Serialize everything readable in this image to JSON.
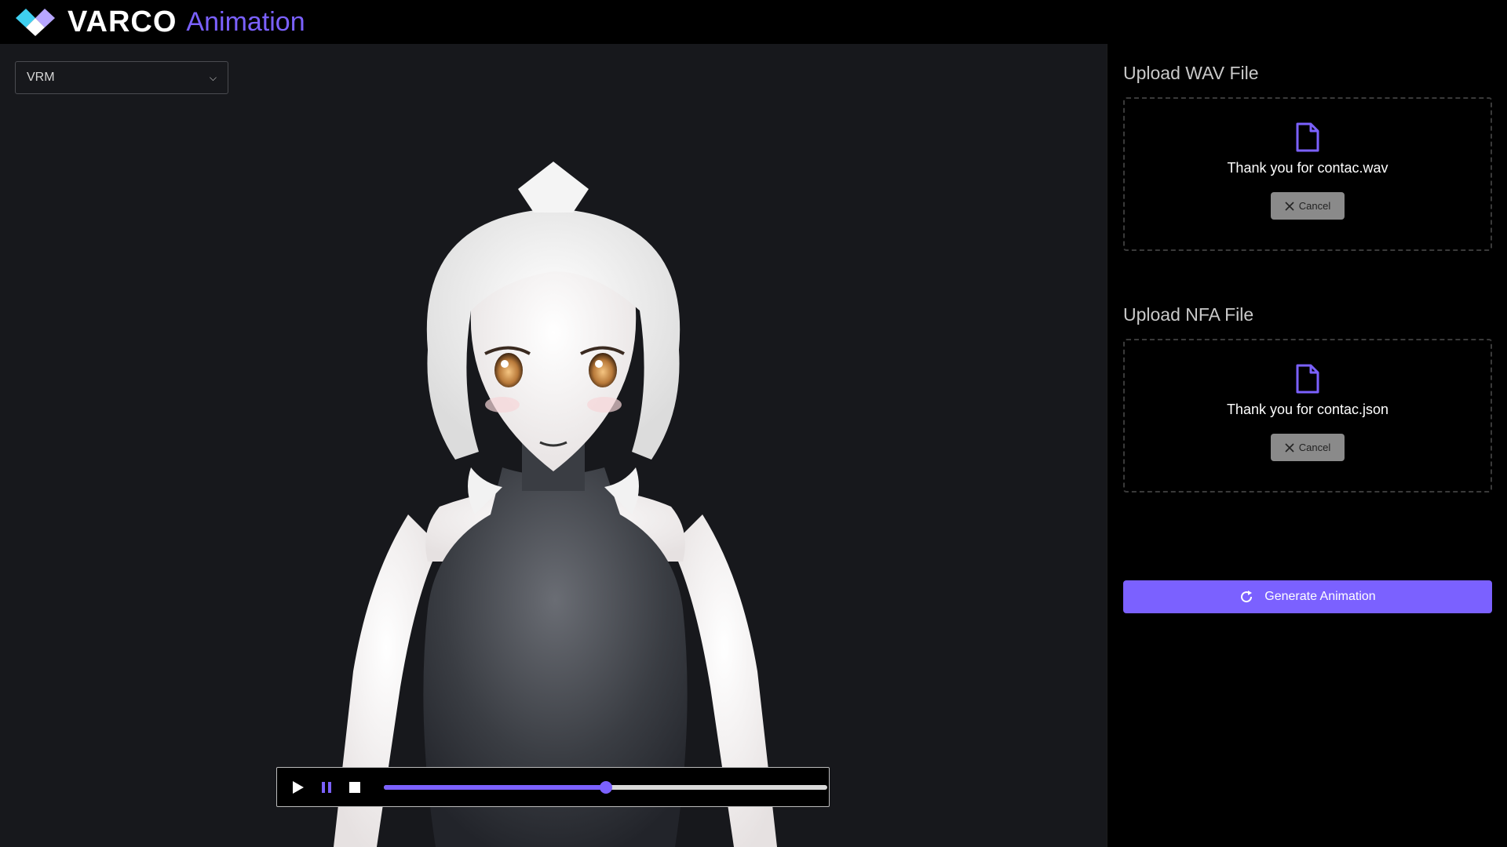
{
  "header": {
    "brand": "VARCO",
    "product": "Animation"
  },
  "viewer": {
    "model_select": "VRM",
    "playback_progress": 0.5
  },
  "wav_upload": {
    "title": "Upload WAV File",
    "file_name": "Thank you for contac.wav",
    "cancel_label": "Cancel"
  },
  "nfa_upload": {
    "title": "Upload NFA File",
    "file_name": "Thank you for contac.json",
    "cancel_label": "Cancel"
  },
  "actions": {
    "generate_label": "Generate Animation"
  },
  "colors": {
    "accent": "#7b61ff",
    "logo_cyan": "#3fd0f0"
  }
}
